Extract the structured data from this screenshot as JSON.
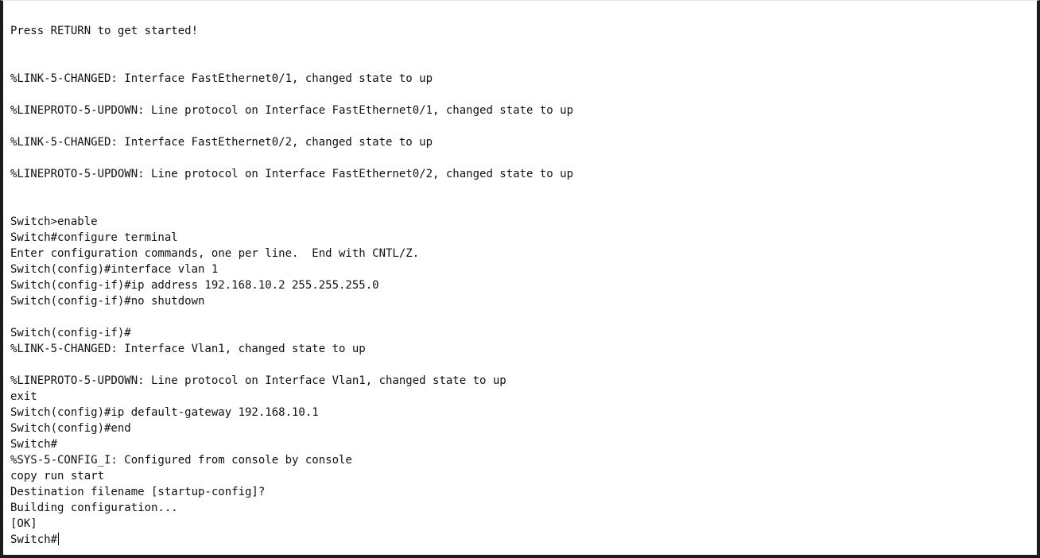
{
  "console": {
    "lines": [
      "Press RETURN to get started!",
      "",
      "",
      "%LINK-5-CHANGED: Interface FastEthernet0/1, changed state to up",
      "",
      "%LINEPROTO-5-UPDOWN: Line protocol on Interface FastEthernet0/1, changed state to up",
      "",
      "%LINK-5-CHANGED: Interface FastEthernet0/2, changed state to up",
      "",
      "%LINEPROTO-5-UPDOWN: Line protocol on Interface FastEthernet0/2, changed state to up",
      "",
      "",
      "Switch>enable",
      "Switch#configure terminal",
      "Enter configuration commands, one per line.  End with CNTL/Z.",
      "Switch(config)#interface vlan 1",
      "Switch(config-if)#ip address 192.168.10.2 255.255.255.0",
      "Switch(config-if)#no shutdown",
      "",
      "Switch(config-if)#",
      "%LINK-5-CHANGED: Interface Vlan1, changed state to up",
      "",
      "%LINEPROTO-5-UPDOWN: Line protocol on Interface Vlan1, changed state to up",
      "exit",
      "Switch(config)#ip default-gateway 192.168.10.1",
      "Switch(config)#end",
      "Switch#",
      "%SYS-5-CONFIG_I: Configured from console by console",
      "copy run start",
      "Destination filename [startup-config]?",
      "Building configuration...",
      "[OK]"
    ],
    "prompt": "Switch#"
  }
}
